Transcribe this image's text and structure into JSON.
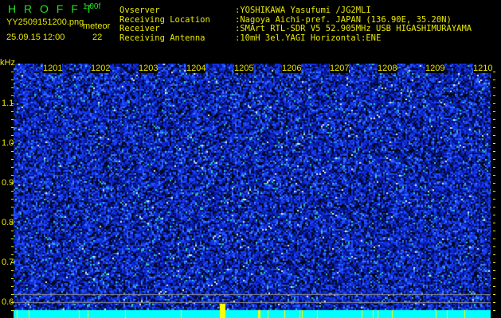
{
  "header": {
    "app_title": "H R O F F T",
    "version": "1.00f",
    "filename": "YY2509151200.png",
    "datetime": "25.09.15 12:00",
    "meteor_label": "meteor",
    "meteor_count": "22"
  },
  "info": [
    {
      "label": "Ovserver",
      "value": ":YOSHIKAWA Yasufumi /JG2MLI"
    },
    {
      "label": "Receiving Location",
      "value": ":Nagoya Aichi-pref. JAPAN (136.90E, 35.20N)"
    },
    {
      "label": "Receiver",
      "value": ":SMArt RTL-SDR V5 52.905MHz USB HIGASHIMURAYAMA"
    },
    {
      "label": "Receiving Antenna",
      "value": ":10mH 3el.YAGI Horizontal:ENE"
    }
  ],
  "axis": {
    "y_unit": "kHz",
    "y_ticks": [
      "1.1",
      "1.0",
      "0.9",
      "0.8",
      "0.7",
      "0.6"
    ],
    "x_ticks": [
      "1201",
      "1202",
      "1203",
      "1204",
      "1205",
      "1206",
      "1207",
      "1208",
      "1209",
      "1210"
    ]
  },
  "colors": {
    "text": "#e8e800",
    "title": "#22e022",
    "noise": "#1030d0",
    "band": "#00ffff"
  }
}
